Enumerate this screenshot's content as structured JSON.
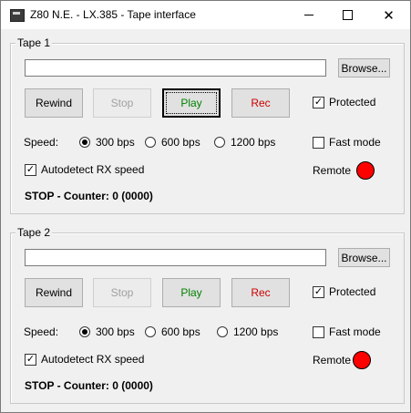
{
  "window": {
    "title": "Z80 N.E. - LX.385 - Tape interface",
    "icon": "computer-icon"
  },
  "tapes": [
    {
      "group_label": "Tape 1",
      "file_path": "",
      "browse_label": "Browse...",
      "rewind_label": "Rewind",
      "stop_label": "Stop",
      "play_label": "Play",
      "rec_label": "Rec",
      "protected_label": "Protected",
      "protected_checked": true,
      "speed_label": "Speed:",
      "speed_options": [
        "300 bps",
        "600 bps",
        "1200 bps"
      ],
      "speed_selected": "300 bps",
      "fast_mode_label": "Fast mode",
      "fast_mode_checked": false,
      "autodetect_label": "Autodetect RX speed",
      "autodetect_checked": true,
      "remote_label": "Remote",
      "remote_color": "#ff0000",
      "status": "STOP - Counter: 0 (0000)"
    },
    {
      "group_label": "Tape 2",
      "file_path": "",
      "browse_label": "Browse...",
      "rewind_label": "Rewind",
      "stop_label": "Stop",
      "play_label": "Play",
      "rec_label": "Rec",
      "protected_label": "Protected",
      "protected_checked": true,
      "speed_label": "Speed:",
      "speed_options": [
        "300 bps",
        "600 bps",
        "1200 bps"
      ],
      "speed_selected": "300 bps",
      "fast_mode_label": "Fast mode",
      "fast_mode_checked": false,
      "autodetect_label": "Autodetect RX speed",
      "autodetect_checked": true,
      "remote_label": "Remote",
      "remote_color": "#ff0000",
      "status": "STOP - Counter: 0 (0000)"
    }
  ],
  "colors": {
    "play": "#008000",
    "rec": "#cc0000",
    "disabled": "#a0a0a0"
  }
}
